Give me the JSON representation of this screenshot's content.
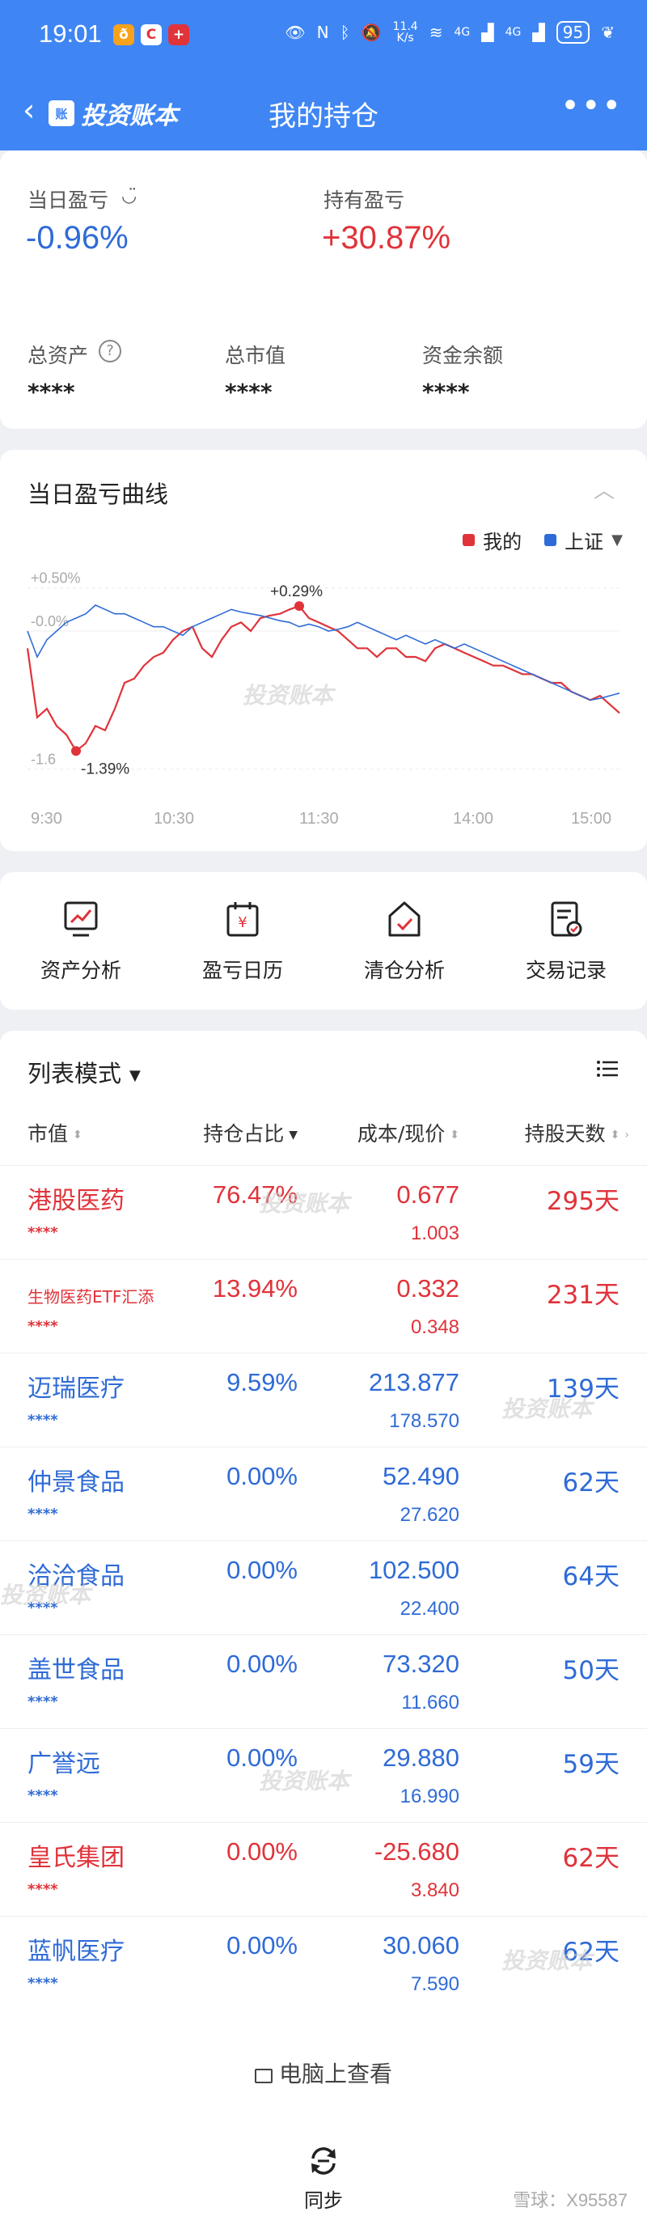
{
  "status_bar": {
    "time": "19:01",
    "network_speed": "11.4\nK/s",
    "signal_1": "4G",
    "signal_2": "4G",
    "battery": "95"
  },
  "nav": {
    "brand": "投资账本",
    "title": "我的持仓"
  },
  "summary": {
    "daily_pnl_label": "当日盈亏",
    "daily_pnl_value": "-0.96%",
    "holding_pnl_label": "持有盈亏",
    "holding_pnl_value": "+30.87%",
    "total_assets_label": "总资产",
    "total_assets_value": "****",
    "market_value_label": "总市值",
    "market_value_value": "****",
    "cash_label": "资金余额",
    "cash_value": "****"
  },
  "chart_card": {
    "title": "当日盈亏曲线",
    "legend_mine": "我的",
    "legend_index": "上证",
    "color_mine": "#e0333a",
    "color_index": "#2f6bd6"
  },
  "chart_data": {
    "type": "line",
    "y_tick_labels": [
      "+0.50%",
      "-0.0%",
      "-1.6"
    ],
    "x_tick_labels": [
      "9:30",
      "10:30",
      "11:30",
      "14:00",
      "15:00"
    ],
    "annotations": {
      "max": "+0.29%",
      "min": "-1.39%"
    },
    "ylim": [
      -1.65,
      0.6
    ],
    "series": [
      {
        "name": "我的",
        "values": [
          -0.2,
          -1.0,
          -0.9,
          -1.1,
          -1.2,
          -1.39,
          -1.3,
          -1.1,
          -1.15,
          -0.9,
          -0.6,
          -0.55,
          -0.4,
          -0.3,
          -0.25,
          -0.1,
          0.0,
          0.05,
          -0.2,
          -0.3,
          -0.1,
          0.05,
          0.1,
          0.0,
          0.15,
          0.18,
          0.2,
          0.25,
          0.29,
          0.15,
          0.1,
          0.05,
          0.0,
          -0.1,
          -0.2,
          -0.2,
          -0.3,
          -0.2,
          -0.2,
          -0.3,
          -0.3,
          -0.35,
          -0.2,
          -0.15,
          -0.2,
          -0.25,
          -0.3,
          -0.35,
          -0.4,
          -0.4,
          -0.45,
          -0.5,
          -0.5,
          -0.55,
          -0.6,
          -0.6,
          -0.7,
          -0.75,
          -0.8,
          -0.75,
          -0.85,
          -0.95
        ]
      },
      {
        "name": "上证",
        "values": [
          0.0,
          -0.3,
          -0.1,
          0.0,
          0.1,
          0.15,
          0.2,
          0.3,
          0.25,
          0.2,
          0.2,
          0.15,
          0.1,
          0.05,
          0.05,
          0.0,
          -0.05,
          0.05,
          0.1,
          0.15,
          0.2,
          0.25,
          0.22,
          0.2,
          0.18,
          0.15,
          0.12,
          0.1,
          0.05,
          0.08,
          0.05,
          0.0,
          0.02,
          0.05,
          0.1,
          0.05,
          0.0,
          -0.05,
          -0.1,
          -0.05,
          -0.1,
          -0.15,
          -0.1,
          -0.15,
          -0.2,
          -0.15,
          -0.2,
          -0.25,
          -0.3,
          -0.35,
          -0.4,
          -0.45,
          -0.5,
          -0.55,
          -0.6,
          -0.65,
          -0.7,
          -0.75,
          -0.8,
          -0.78,
          -0.75,
          -0.72
        ]
      }
    ],
    "grid": true
  },
  "actions": [
    {
      "label": "资产分析",
      "icon": "chart-monitor-icon"
    },
    {
      "label": "盈亏日历",
      "icon": "calendar-yen-icon"
    },
    {
      "label": "清仓分析",
      "icon": "house-check-icon"
    },
    {
      "label": "交易记录",
      "icon": "document-check-icon"
    }
  ],
  "list": {
    "mode": "列表模式",
    "columns": [
      "市值",
      "持仓占比",
      "成本/现价",
      "持股天数"
    ],
    "rows": [
      {
        "name": "港股医药",
        "masked": "****",
        "ratio": "76.47%",
        "cost": "0.677",
        "price": "1.003",
        "days": "295天",
        "tone": "red"
      },
      {
        "name": "生物医药ETF汇添",
        "masked": "****",
        "ratio": "13.94%",
        "cost": "0.332",
        "price": "0.348",
        "days": "231天",
        "tone": "red"
      },
      {
        "name": "迈瑞医疗",
        "masked": "****",
        "ratio": "9.59%",
        "cost": "213.877",
        "price": "178.570",
        "days": "139天",
        "tone": "blue"
      },
      {
        "name": "仲景食品",
        "masked": "****",
        "ratio": "0.00%",
        "cost": "52.490",
        "price": "27.620",
        "days": "62天",
        "tone": "blue"
      },
      {
        "name": "洽洽食品",
        "masked": "****",
        "ratio": "0.00%",
        "cost": "102.500",
        "price": "22.400",
        "days": "64天",
        "tone": "blue"
      },
      {
        "name": "盖世食品",
        "masked": "****",
        "ratio": "0.00%",
        "cost": "73.320",
        "price": "11.660",
        "days": "50天",
        "tone": "blue"
      },
      {
        "name": "广誉远",
        "masked": "****",
        "ratio": "0.00%",
        "cost": "29.880",
        "price": "16.990",
        "days": "59天",
        "tone": "blue"
      },
      {
        "name": "皇氏集团",
        "masked": "****",
        "ratio": "0.00%",
        "cost": "-25.680",
        "price": "3.840",
        "days": "62天",
        "tone": "red"
      },
      {
        "name": "蓝帆医疗",
        "masked": "****",
        "ratio": "0.00%",
        "cost": "30.060",
        "price": "7.590",
        "days": "62天",
        "tone": "blue"
      }
    ],
    "pc_view": "电脑上查看"
  },
  "bottom": {
    "sync_label": "同步",
    "xueqiu": "雪球：X95587"
  },
  "watermark": "投资账本"
}
